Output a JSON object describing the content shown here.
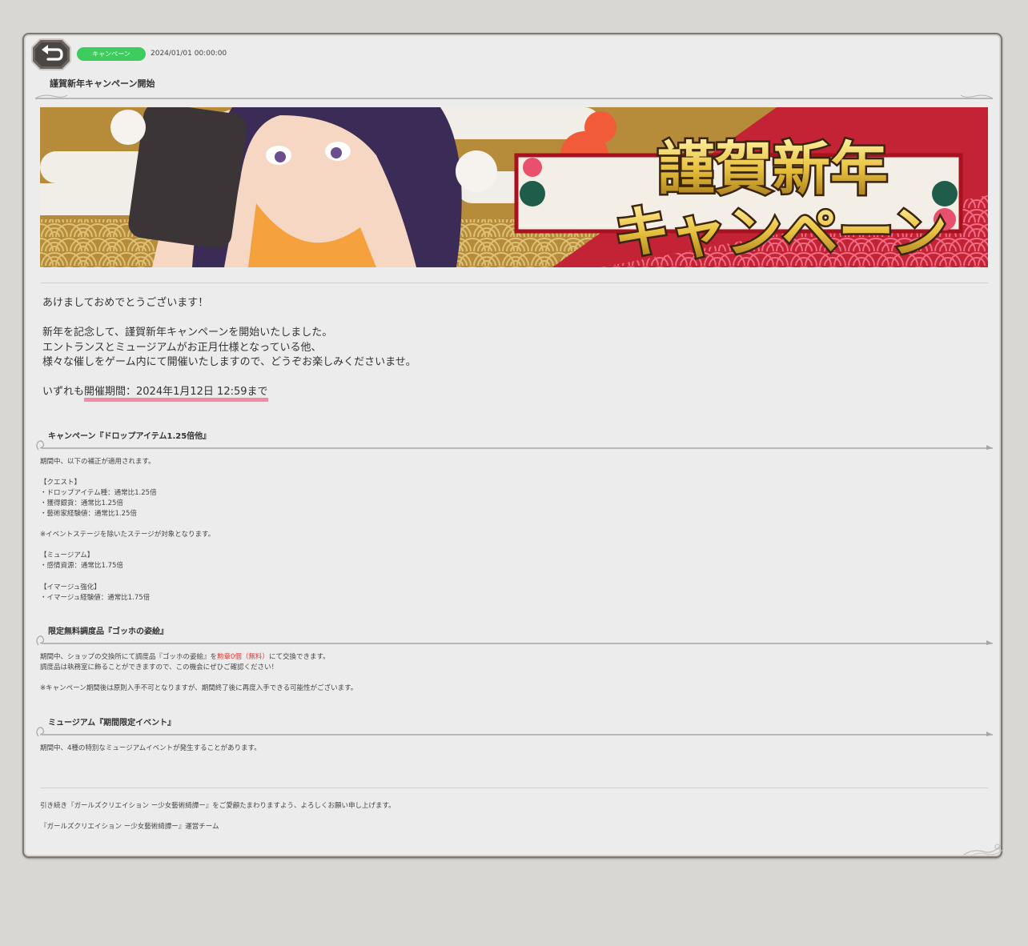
{
  "header": {
    "category_badge": "キャンペーン",
    "date": "2024/01/01 00:00:00",
    "title": "謹賀新年キャンペーン開始"
  },
  "banner": {
    "line1": "謹賀新年",
    "line2": "キャンペーン"
  },
  "intro": {
    "greeting": "あけましておめでとうございます！",
    "p1": "新年を記念して、謹賀新年キャンペーンを開始いたしました。",
    "p2": "エントランスとミュージアムがお正月仕様となっている他、",
    "p3": "様々な催しをゲーム内にて開催いたしますので、どうぞお楽しみくださいませ。",
    "period_prefix": "いずれも",
    "period": "開催期間：2024年1月12日 12:59まで"
  },
  "sections": [
    {
      "heading": "キャンペーン『ドロップアイテム1.25倍他』",
      "lines": [
        "期間中、以下の補正が適用されます。",
        "",
        "【クエスト】",
        "・ドロップアイテム種：通常比1.25倍",
        "・獲得銀貨：通常比1.25倍",
        "・藝術家経験値：通常比1.25倍",
        "",
        "※イベントステージを除いたステージが対象となります。",
        "",
        "【ミュージアム】",
        "・感情資源：通常比1.75倍",
        "",
        "【イマージュ強化】",
        "・イマージュ経験値：通常比1.75倍"
      ]
    },
    {
      "heading": "限定無料調度品『ゴッホの姿絵』",
      "line1_before": "期間中、ショップの交換所にて調度品『ゴッホの姿絵』を",
      "line1_red": "勲章0個（無料）",
      "line1_after": "にて交換できます。",
      "line2": "調度品は執務室に飾ることができますので、この機会にぜひご確認ください！",
      "line3": "",
      "line4": "※キャンペーン期間後は原則入手不可となりますが、期間終了後に再度入手できる可能性がございます。"
    },
    {
      "heading": "ミュージアム『期間限定イベント』",
      "line1": "期間中、4種の特別なミュージアムイベントが発生することがあります。"
    }
  ],
  "footer": {
    "line1": "引き続き『ガールズクリエイション ー少女藝術綺譚ー』をご愛顧たまわりますよう、よろしくお願い申し上げます。",
    "line2": "『ガールズクリエイション ー少女藝術綺譚ー』運営チーム"
  },
  "colors": {
    "badge": "#3ecc5f",
    "highlight": "#f08ca8",
    "red_text": "#e03a3a",
    "banner_red": "#c42235",
    "banner_gold": "#d8b23b"
  }
}
